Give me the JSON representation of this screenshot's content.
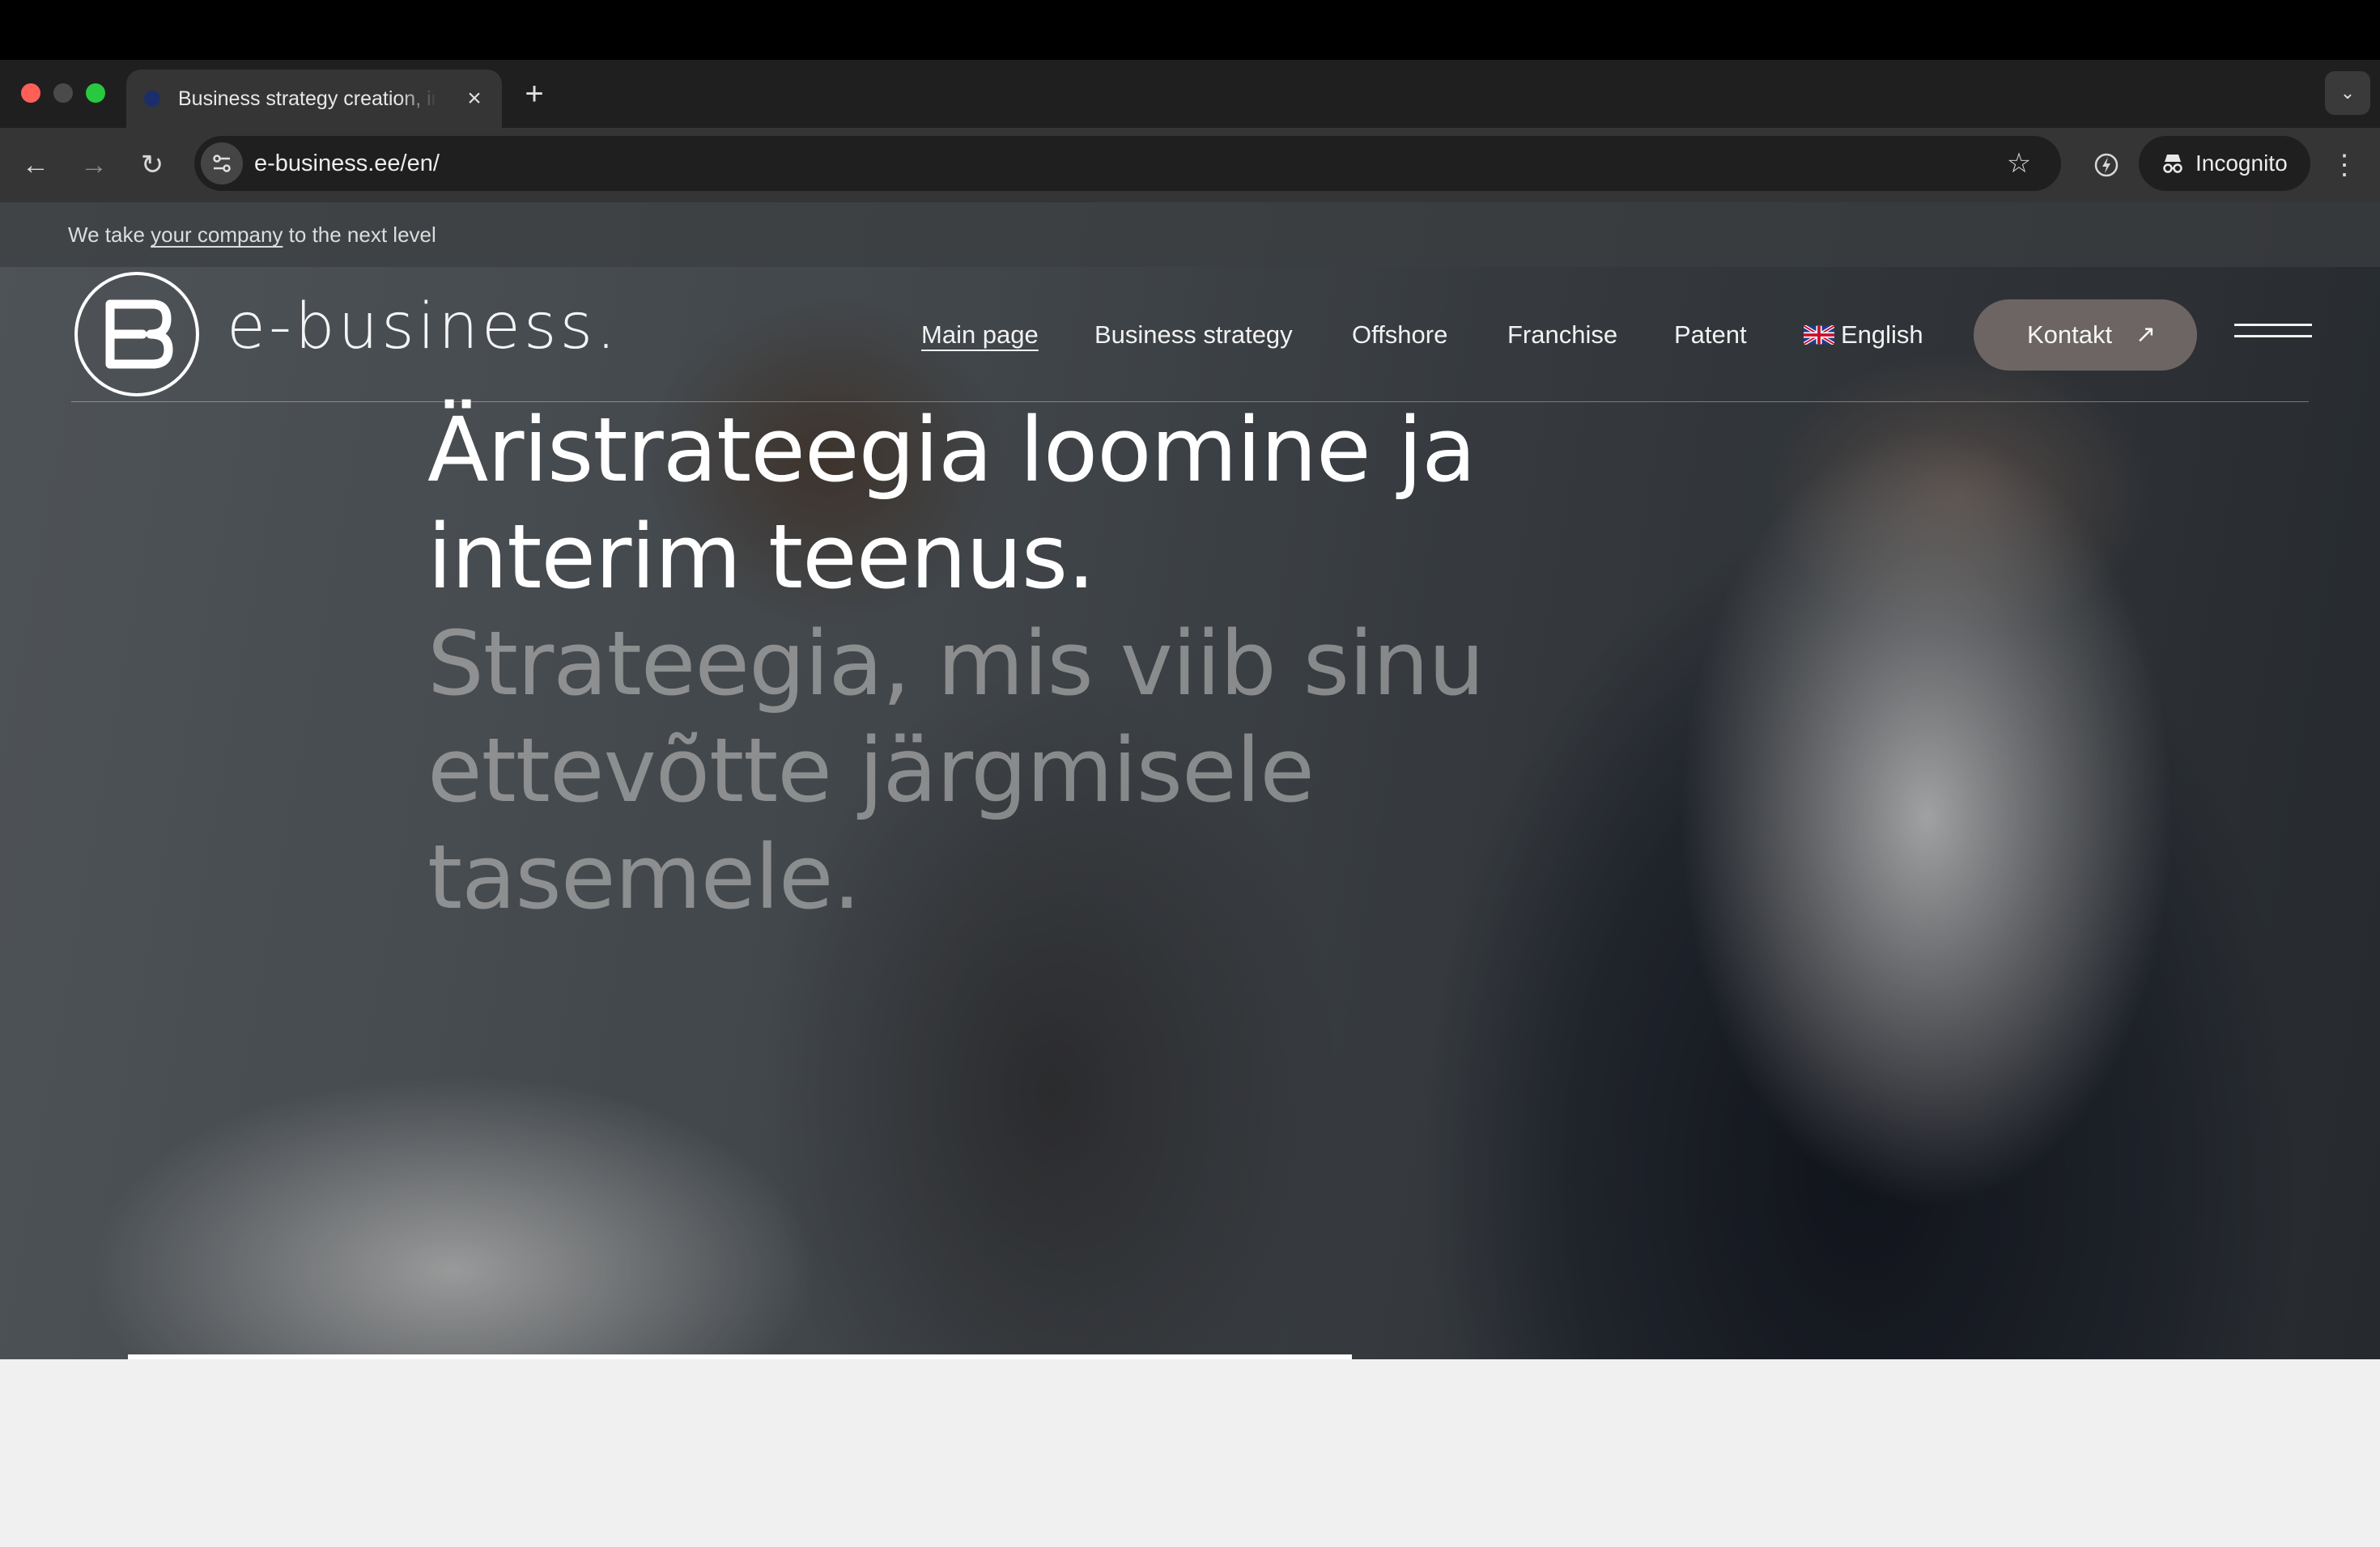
{
  "browser": {
    "tab_title": "Business strategy creation, interim service",
    "url": "e-business.ee/en/",
    "incognito_label": "Incognito",
    "icons": {
      "back": "arrow-left-icon",
      "forward": "arrow-right-icon",
      "reload": "reload-icon",
      "site_info": "tune-icon",
      "bookmark": "star-icon",
      "extension": "extension-icon",
      "incognito": "incognito-icon",
      "menu": "kebab-icon",
      "close_tab": "close-icon",
      "new_tab": "plus-icon",
      "tab_search": "chevron-down-icon"
    }
  },
  "site": {
    "announce": {
      "before": "We take ",
      "link": "your company",
      "after": " to the next level"
    },
    "logo_text": "e-business.",
    "nav": [
      {
        "label": "Main page",
        "active": true
      },
      {
        "label": "Business strategy"
      },
      {
        "label": "Offshore"
      },
      {
        "label": "Franchise"
      },
      {
        "label": "Patent"
      }
    ],
    "language": "English",
    "cta_label": "Kontakt",
    "cta_icon": "arrow-up-right-icon",
    "hero_title": "Äristrateegia loomine ja interim teenus.",
    "hero_subtitle": "Strateegia, mis viib sinu ettevõtte järgmisele tasemele."
  },
  "colors": {
    "accent_button": "#786e6c",
    "text_primary": "#ffffff",
    "text_muted": "#c8c8c8"
  }
}
